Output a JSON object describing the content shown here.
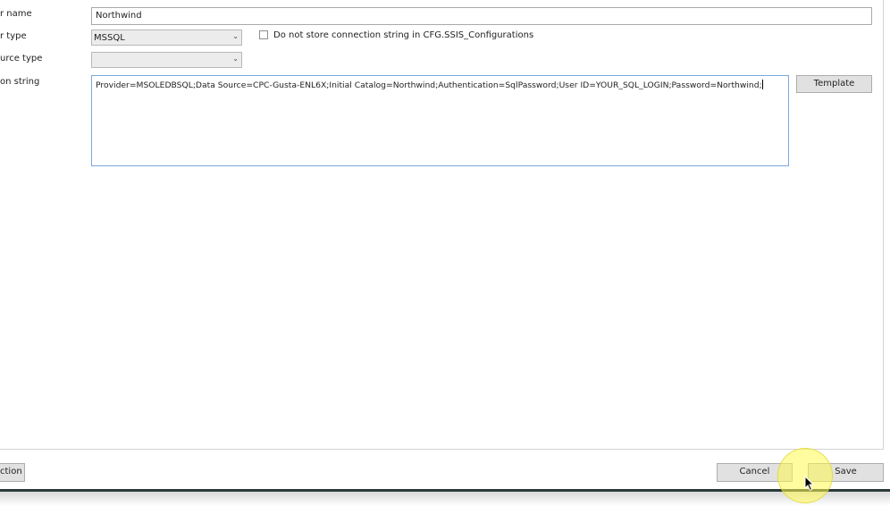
{
  "form": {
    "server_name_label": "r name",
    "server_name_value": "Northwind",
    "server_type_label": "r type",
    "server_type_value": "MSSQL",
    "source_type_label": "urce type",
    "source_type_value": "",
    "connection_string_label": "on string",
    "connection_string_value": "Provider=MSOLEDBSQL;Data Source=CPC-Gusta-ENL6X;Initial Catalog=Northwind;Authentication=SqlPassword;User ID=YOUR_SQL_LOGIN;Password=Northwind;",
    "do_not_store_label": "Do not store connection string in CFG.SSIS_Configurations",
    "do_not_store_checked": false,
    "template_button": "Template"
  },
  "footer": {
    "left_button": "ction",
    "cancel_button": "Cancel",
    "save_button": "Save"
  },
  "icons": {
    "dropdown": "chevron-down-icon",
    "cursor": "mouse-pointer-icon"
  }
}
